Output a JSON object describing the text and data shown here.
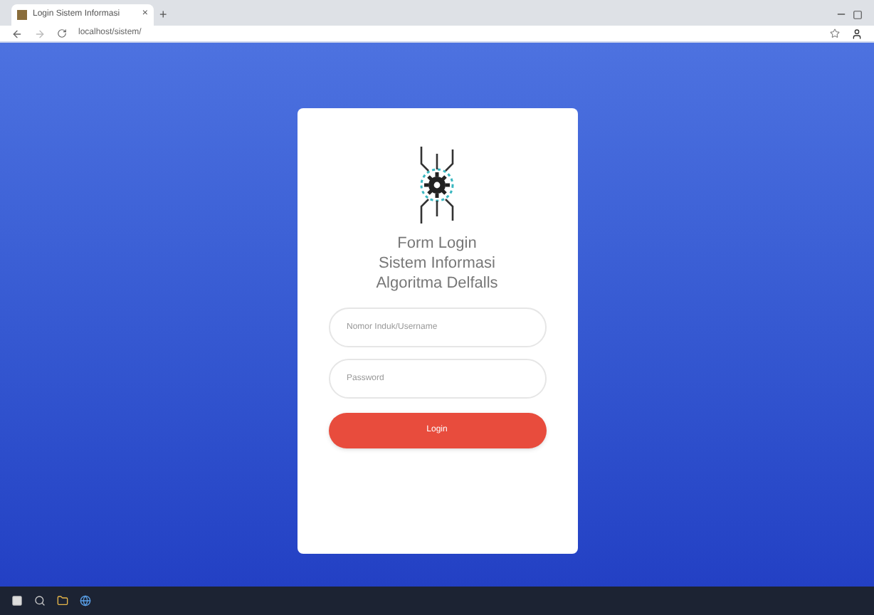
{
  "browser": {
    "tab_title": "Login Sistem Informasi",
    "tab_close": "×",
    "new_tab": "+",
    "address": "localhost/sistem/"
  },
  "login": {
    "title_lines": [
      "Form Login",
      "Sistem Informasi",
      "Algoritma Delfalls"
    ],
    "username": {
      "placeholder": "Nomor Induk/Username"
    },
    "password": {
      "placeholder": "Password"
    },
    "button": "Login"
  }
}
